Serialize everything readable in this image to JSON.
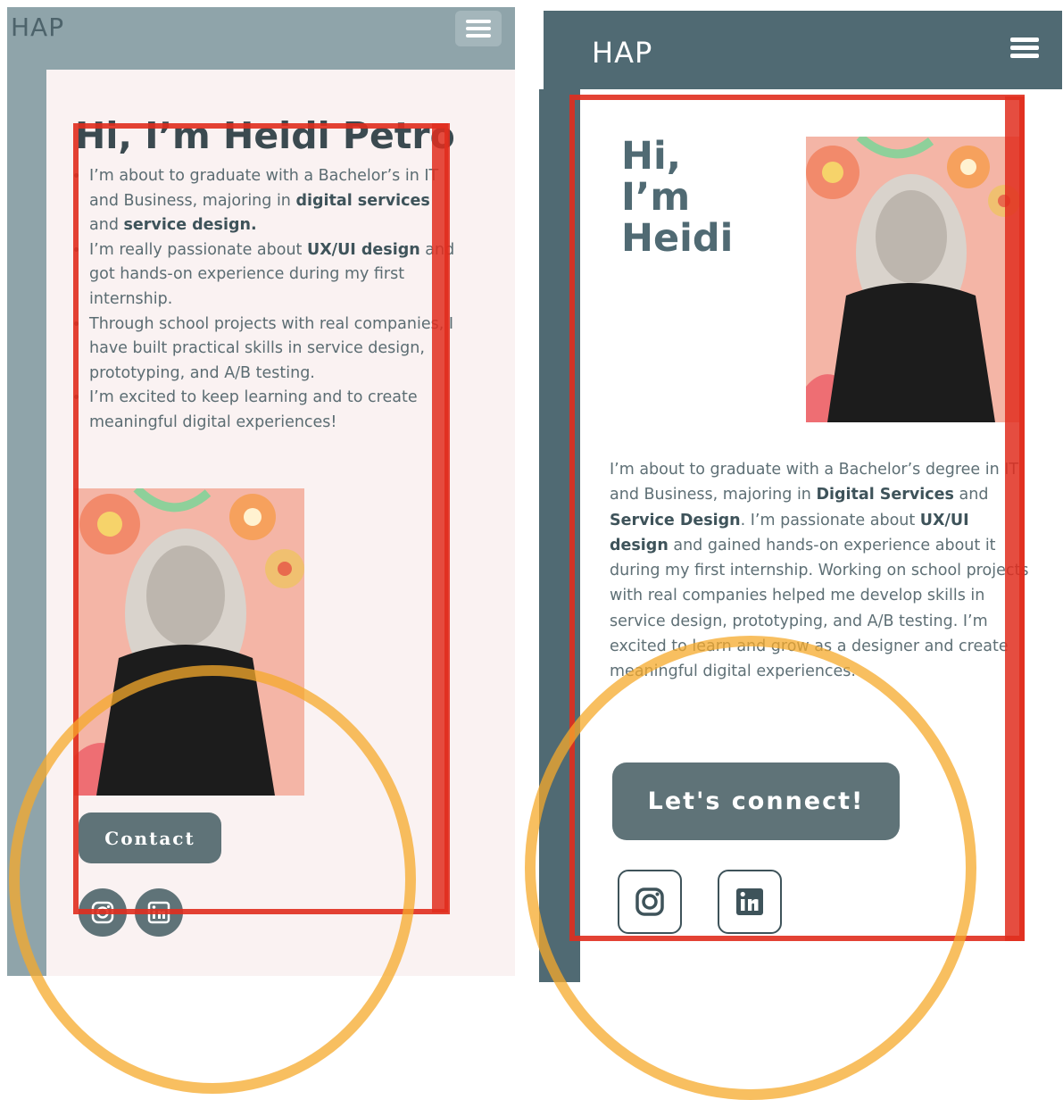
{
  "left_mockup": {
    "logo": "HAP",
    "menu_icon": "hamburger-menu-icon",
    "title": "Hi, I’m Heidi Petro",
    "bullets": [
      {
        "text_before": "I’m about to graduate with a Bachelor’s in IT and Business, majoring in ",
        "bold": "digital services",
        "text_mid": " and ",
        "bold2": "service design.",
        "text_after": ""
      },
      {
        "text_before": "I’m really passionate about ",
        "bold": "UX/UI design",
        "text_after": " and got hands-on experience during my first internship."
      },
      {
        "text": "Through school projects with real companies, I have built practical skills in service design, prototyping, and A/B testing."
      },
      {
        "text": "I’m excited to keep learning and to create meaningful digital experiences!"
      }
    ],
    "contact_button": "Contact",
    "social_icons": [
      "instagram-icon",
      "linkedin-icon"
    ]
  },
  "right_mockup": {
    "logo": "HAP",
    "menu_icon": "hamburger-menu-icon",
    "title_lines": [
      "Hi,",
      "I’m",
      "Heidi"
    ],
    "paragraph": {
      "p1": "I’m about to graduate with a Bachelor’s degree in IT and Business, majoring in ",
      "b1": "Digital Services",
      "p2": " and ",
      "b2": "Service Design",
      "p3": ". I’m passionate about ",
      "b3": "UX/UI design",
      "p4": " and gained hands-on experience about it during my first internship. Working on school projects with real companies helped me develop skills in service design, prototyping, and A/B testing. I’m excited to learn and grow as a designer and create meaningful digital experiences."
    },
    "connect_button": "Let's connect!",
    "social_icons": [
      "instagram-icon",
      "linkedin-icon"
    ]
  },
  "colors": {
    "left_header": "#8fa4aa",
    "right_header": "#506a73",
    "button": "#5f7378",
    "annotation_red": "#e02e1e",
    "annotation_orange": "#f6a92b"
  }
}
